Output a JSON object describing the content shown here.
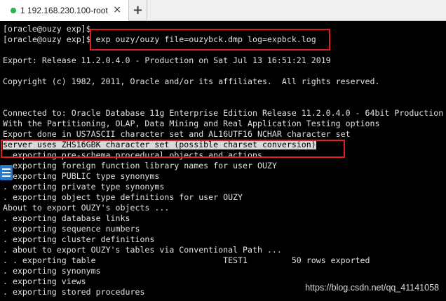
{
  "tab": {
    "label": "1 192.168.230.100-root",
    "close_glyph": "×",
    "status_color": "#2bb24c"
  },
  "new_tab_glyph": "+",
  "terminal": {
    "lines": [
      "[oracle@ouzy exp]$ ",
      "[oracle@ouzy exp]$ exp ouzy/ouzy file=ouzybck.dmp log=expbck.log",
      "",
      "Export: Release 11.2.0.4.0 - Production on Sat Jul 13 16:51:21 2019",
      "",
      "Copyright (c) 1982, 2011, Oracle and/or its affiliates.  All rights reserved.",
      "",
      "",
      "Connected to: Oracle Database 11g Enterprise Edition Release 11.2.0.4.0 - 64bit Production",
      "With the Partitioning, OLAP, Data Mining and Real Application Testing options",
      "Export done in US7ASCII character set and AL16UTF16 NCHAR character set",
      "server uses ZHS16GBK character set (possible charset conversion)",
      ". exporting pre-schema procedural objects and actions",
      ". exporting foreign function library names for user OUZY",
      ". exporting PUBLIC type synonyms",
      ". exporting private type synonyms",
      ". exporting object type definitions for user OUZY",
      "About to export OUZY's objects ...",
      ". exporting database links",
      ". exporting sequence numbers",
      ". exporting cluster definitions",
      ". about to export OUZY's tables via Conventional Path ...",
      ". . exporting table                          TEST1         50 rows exported",
      ". exporting synonyms",
      ". exporting views",
      ". exporting stored procedures"
    ]
  },
  "watermark": "https://blog.csdn.net/qq_41141058",
  "colors": {
    "terminal_bg": "#000000",
    "terminal_fg": "#e0e0e0",
    "highlight_bg": "#d8d8d8",
    "annotation_red": "#e02020",
    "side_icon": "#2a78c8"
  }
}
